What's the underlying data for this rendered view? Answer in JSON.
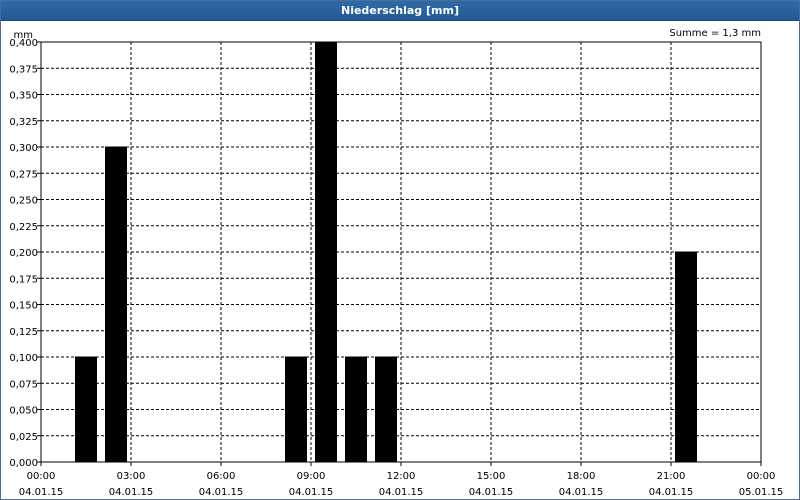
{
  "window": {
    "title": "Niederschlag [mm]"
  },
  "chart_data": {
    "type": "bar",
    "title": "Niederschlag [mm]",
    "ylabel": "mm",
    "xlabel": "",
    "summary": "Summe = 1,3 mm",
    "ylim": [
      0,
      0.4
    ],
    "y_ticks": [
      "0,000",
      "0,025",
      "0,050",
      "0,075",
      "0,100",
      "0,125",
      "0,150",
      "0,175",
      "0,200",
      "0,225",
      "0,250",
      "0,275",
      "0,300",
      "0,325",
      "0,350",
      "0,375",
      "0,400"
    ],
    "x_range_hours": [
      0,
      24
    ],
    "x_ticks": [
      {
        "time": "00:00",
        "date": "04.01.15"
      },
      {
        "time": "03:00",
        "date": "04.01.15"
      },
      {
        "time": "06:00",
        "date": "04.01.15"
      },
      {
        "time": "09:00",
        "date": "04.01.15"
      },
      {
        "time": "12:00",
        "date": "04.01.15"
      },
      {
        "time": "15:00",
        "date": "04.01.15"
      },
      {
        "time": "18:00",
        "date": "04.01.15"
      },
      {
        "time": "21:00",
        "date": "04.01.15"
      },
      {
        "time": "00:00",
        "date": "05.01.15"
      }
    ],
    "bars": [
      {
        "time": "01:30",
        "value": 0.1
      },
      {
        "time": "02:30",
        "value": 0.3
      },
      {
        "time": "08:30",
        "value": 0.1
      },
      {
        "time": "09:30",
        "value": 0.4
      },
      {
        "time": "10:30",
        "value": 0.1
      },
      {
        "time": "11:30",
        "value": 0.1
      },
      {
        "time": "21:30",
        "value": 0.2
      }
    ],
    "grid": true,
    "bar_color": "#000000",
    "grid_color": "#000000"
  }
}
